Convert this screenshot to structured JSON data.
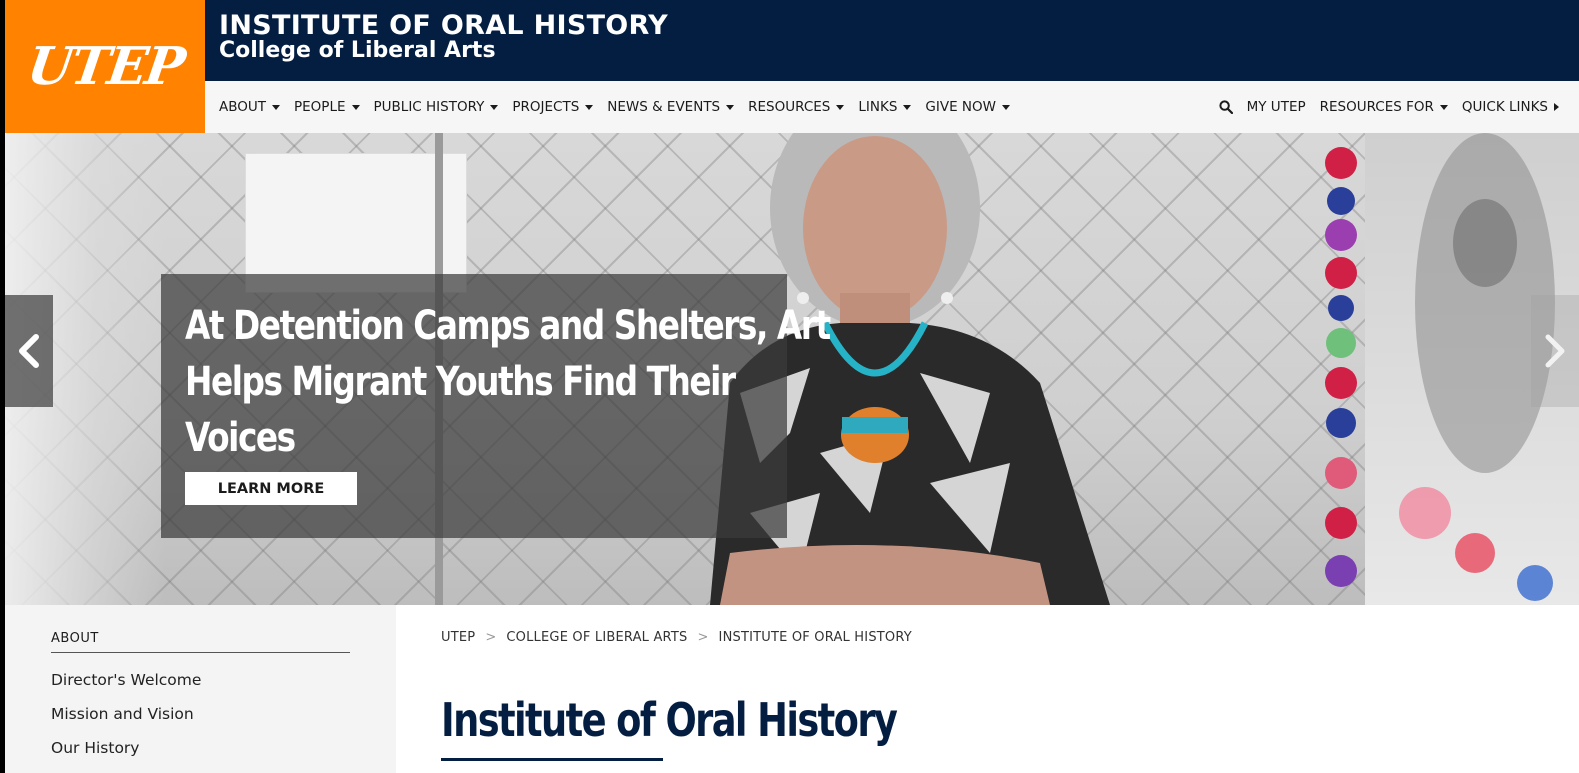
{
  "header": {
    "logo_text": "UTEP",
    "title": "INSTITUTE OF ORAL HISTORY",
    "subtitle": "College of Liberal Arts",
    "colors": {
      "orange": "#ff8200",
      "navy": "#041e42"
    }
  },
  "nav": {
    "main": [
      {
        "label": "ABOUT"
      },
      {
        "label": "PEOPLE"
      },
      {
        "label": "PUBLIC HISTORY"
      },
      {
        "label": "PROJECTS"
      },
      {
        "label": "NEWS & EVENTS"
      },
      {
        "label": "RESOURCES"
      },
      {
        "label": "LINKS"
      },
      {
        "label": "GIVE NOW"
      }
    ],
    "utility": {
      "search_icon": "search-icon",
      "my_utep": "MY UTEP",
      "resources_for": "RESOURCES FOR",
      "quick_links": "QUICK LINKS"
    }
  },
  "hero": {
    "caption": "At Detention Camps and Shelters, Art Helps Migrant Youths Find Their Voices",
    "caption_lines": [
      "At Detention Camps and Shelters, Art",
      "Helps Migrant Youths Find Their",
      "Voices"
    ],
    "button": "LEARN MORE",
    "prev_icon": "chevron-left-icon",
    "next_icon": "chevron-right-icon"
  },
  "sidebar": {
    "heading": "ABOUT",
    "links": [
      "Director's Welcome",
      "Mission and Vision",
      "Our History"
    ]
  },
  "breadcrumb": {
    "items": [
      "UTEP",
      "COLLEGE OF LIBERAL ARTS",
      "INSTITUTE OF ORAL HISTORY"
    ],
    "separator": ">"
  },
  "main": {
    "title": "Institute of Oral History"
  }
}
